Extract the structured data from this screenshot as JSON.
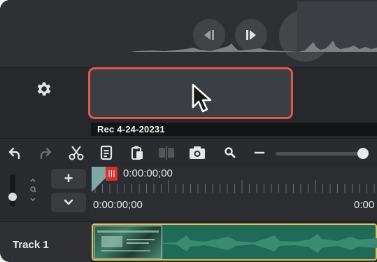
{
  "playback": {
    "prev_icon": "step-back-icon",
    "next_icon": "step-forward-icon",
    "play_icon": "play-icon",
    "more_icon": "chevron-right-icon"
  },
  "clip": {
    "name": "Rec 4-24-20231",
    "highlight_color": "#e5574a"
  },
  "toolbar": {
    "icons": [
      "undo-icon",
      "redo-icon",
      "scissors-icon",
      "copy-icon",
      "paste-icon",
      "split-icon",
      "snapshot-icon",
      "zoom-icon",
      "zoom-out-icon"
    ],
    "zoom_level": 0.95
  },
  "timeline": {
    "playhead_time": "0:00:00;00",
    "ruler_start": "0:00:00;00",
    "ruler_next": "0:00",
    "zoom_in_label": "+"
  },
  "tracks": [
    {
      "label": "Track 1",
      "color": "#1f6b57"
    }
  ]
}
